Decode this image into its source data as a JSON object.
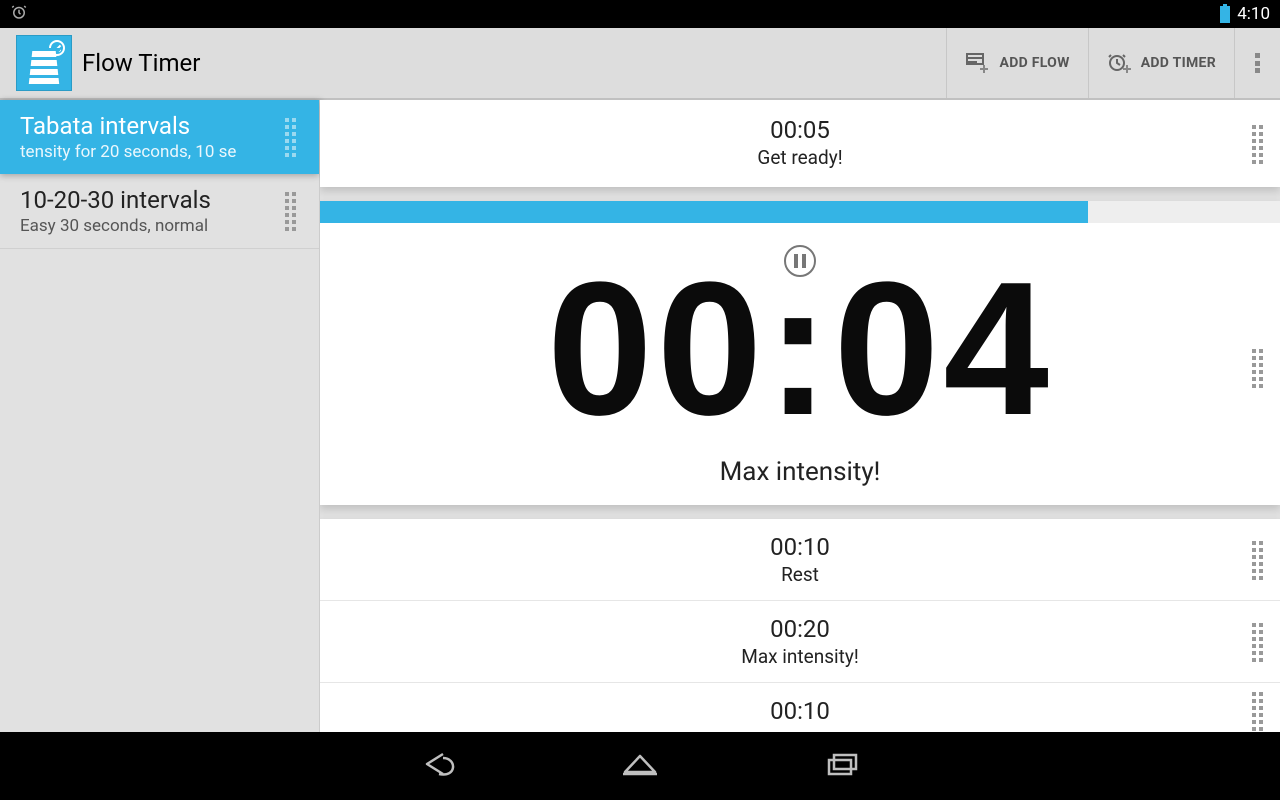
{
  "status": {
    "time": "4:10"
  },
  "action_bar": {
    "title": "Flow Timer",
    "add_flow": "ADD FLOW",
    "add_timer": "ADD TIMER"
  },
  "sidebar": {
    "items": [
      {
        "title": "Tabata intervals",
        "subtitle": "tensity for 20 seconds, 10 se",
        "active": true
      },
      {
        "title": "10-20-30 intervals",
        "subtitle": "Easy 30 seconds, normal",
        "active": false
      }
    ]
  },
  "timers": {
    "top": {
      "time": "00:05",
      "label": "Get ready!"
    },
    "active": {
      "time": "00:04",
      "label": "Max intensity!",
      "progress_pct": 80
    },
    "upcoming": [
      {
        "time": "00:10",
        "label": "Rest"
      },
      {
        "time": "00:20",
        "label": "Max intensity!"
      },
      {
        "time": "00:10",
        "label": ""
      }
    ]
  }
}
